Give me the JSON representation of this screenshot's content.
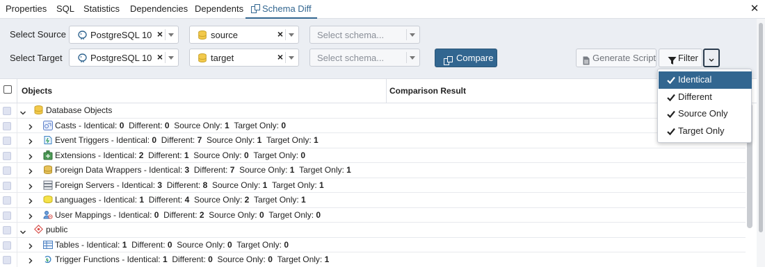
{
  "tabs": [
    {
      "label": "Properties"
    },
    {
      "label": "SQL"
    },
    {
      "label": "Statistics"
    },
    {
      "label": "Dependencies"
    },
    {
      "label": "Dependents"
    },
    {
      "label": "Schema Diff",
      "active": true,
      "icon": "schema-diff-icon"
    }
  ],
  "close_icon": "close-icon",
  "source": {
    "label": "Select Source",
    "server": "PostgreSQL 10",
    "database": "source",
    "schema_placeholder": "Select schema..."
  },
  "target": {
    "label": "Select Target",
    "server": "PostgreSQL 10",
    "database": "target",
    "schema_placeholder": "Select schema..."
  },
  "toolbar": {
    "compare_label": "Compare",
    "generate_label": "Generate Script",
    "filter_label": "Filter"
  },
  "grid": {
    "col_objects": "Objects",
    "col_result": "Comparison Result"
  },
  "filter_menu": {
    "items": [
      {
        "label": "Identical",
        "checked": true,
        "highlighted": true
      },
      {
        "label": "Different",
        "checked": true
      },
      {
        "label": "Source Only",
        "checked": true
      },
      {
        "label": "Target Only",
        "checked": true
      }
    ]
  },
  "colors": {
    "primary": "#326690",
    "panel_bg": "#ebeef3",
    "checkbox_fill": "#dfe3f1"
  },
  "tree": {
    "groups": [
      {
        "label": "Database Objects",
        "icon": "database-objects-icon",
        "expanded": true,
        "children": [
          {
            "name": "Casts",
            "icon": "casts-icon",
            "identical": "0",
            "different": "0",
            "source_only": "1",
            "target_only": "0"
          },
          {
            "name": "Event Triggers",
            "icon": "event-triggers-icon",
            "identical": "0",
            "different": "7",
            "source_only": "1",
            "target_only": "1"
          },
          {
            "name": "Extensions",
            "icon": "extensions-icon",
            "identical": "2",
            "different": "1",
            "source_only": "0",
            "target_only": "0"
          },
          {
            "name": "Foreign Data Wrappers",
            "icon": "foreign-data-wrappers-icon",
            "identical": "3",
            "different": "7",
            "source_only": "1",
            "target_only": "1"
          },
          {
            "name": "Foreign Servers",
            "icon": "foreign-servers-icon",
            "identical": "3",
            "different": "8",
            "source_only": "1",
            "target_only": "1"
          },
          {
            "name": "Languages",
            "icon": "languages-icon",
            "identical": "1",
            "different": "4",
            "source_only": "2",
            "target_only": "1"
          },
          {
            "name": "User Mappings",
            "icon": "user-mappings-icon",
            "identical": "0",
            "different": "2",
            "source_only": "0",
            "target_only": "0"
          }
        ]
      },
      {
        "label": "public",
        "icon": "schema-icon",
        "expanded": true,
        "children": [
          {
            "name": "Tables",
            "icon": "tables-icon",
            "identical": "1",
            "different": "0",
            "source_only": "0",
            "target_only": "0"
          },
          {
            "name": "Trigger Functions",
            "icon": "trigger-functions-icon",
            "identical": "1",
            "different": "0",
            "source_only": "0",
            "target_only": "1"
          }
        ]
      }
    ],
    "field_labels": {
      "identical": " - Identical: ",
      "different": "Different: ",
      "source_only": "Source Only: ",
      "target_only": "Target Only: "
    }
  }
}
